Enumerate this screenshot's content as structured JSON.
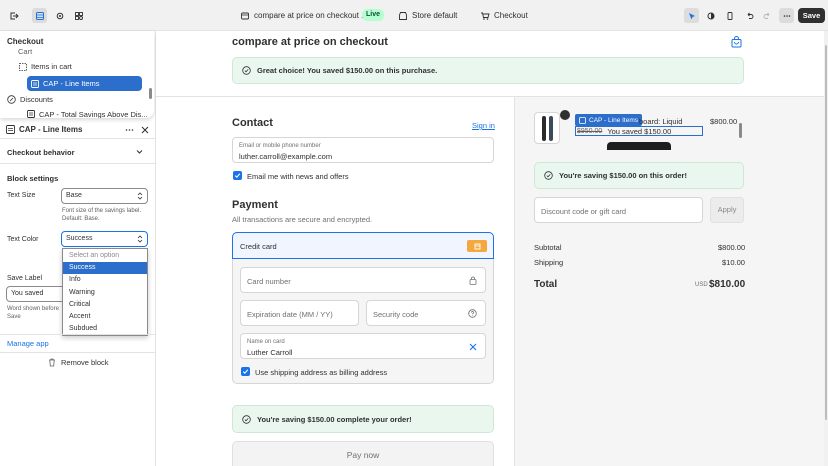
{
  "topbar": {
    "page_title": "compare at price on checkout ...",
    "live_badge": "Live",
    "store_default": "Store default",
    "checkout": "Checkout",
    "save_label": "Save"
  },
  "tree": {
    "title": "Checkout",
    "items": [
      {
        "label": "Cart"
      },
      {
        "label": "Items in cart"
      },
      {
        "label": "CAP - Line Items"
      },
      {
        "label": "Discounts"
      },
      {
        "label": "CAP - Total Savings Above Dis..."
      }
    ]
  },
  "block": {
    "title": "CAP - Line Items",
    "checkout_behavior": "Checkout behavior",
    "block_settings": "Block settings",
    "text_size_label": "Text Size",
    "text_size_value": "Base",
    "text_size_help1": "Font size of the savings label.",
    "text_size_help2": "Default: Base.",
    "text_color_label": "Text Color",
    "text_color_value": "Success",
    "save_label_label": "Save Label",
    "save_label_value": "You saved",
    "save_label_help1": "Word shown before",
    "save_label_help2": "Save",
    "manage_app": "Manage app",
    "remove_block": "Remove block"
  },
  "dropdown": {
    "options": [
      "Select an option",
      "Success",
      "Info",
      "Warning",
      "Critical",
      "Accent",
      "Subdued"
    ],
    "selected": "Success"
  },
  "preview": {
    "header_title": "compare at price on checkout",
    "top_banner": "Great choice! You saved $150.00 on this purchase.",
    "contact_heading": "Contact",
    "sign_in": "Sign in",
    "email_label": "Email or mobile phone number",
    "email_value": "luther.carroll@example.com",
    "email_news": "Email me with news and offers",
    "payment_heading": "Payment",
    "payment_sub": "All transactions are secure and encrypted.",
    "credit_card": "Credit card",
    "card_number_ph": "Card number",
    "expiration_ph": "Expiration date (MM / YY)",
    "security_ph": "Security code",
    "name_label": "Name on card",
    "name_value": "Luther Carroll",
    "billing_same": "Use shipping address as billing address",
    "bottom_banner": "You're saving $150.00 complete your order!",
    "pay_now": "Pay now"
  },
  "summary": {
    "product_name_partial": "board: Liquid",
    "product_price": "$800.00",
    "block_tag": "CAP - Line Items",
    "compare_price": "$950.00",
    "saved_text": "You saved $150.00",
    "saving_banner": "You're saving $150.00 on this order!",
    "discount_ph": "Discount code or gift card",
    "apply": "Apply",
    "subtotal_label": "Subtotal",
    "subtotal_value": "$800.00",
    "shipping_label": "Shipping",
    "shipping_value": "$10.00",
    "total_label": "Total",
    "currency": "USD",
    "total_value": "$810.00"
  },
  "colors": {
    "accent": "#1a73e8",
    "selection": "#2c6ecb",
    "success_bg": "#eaf7ee",
    "credit_badge": "#f4a940"
  }
}
